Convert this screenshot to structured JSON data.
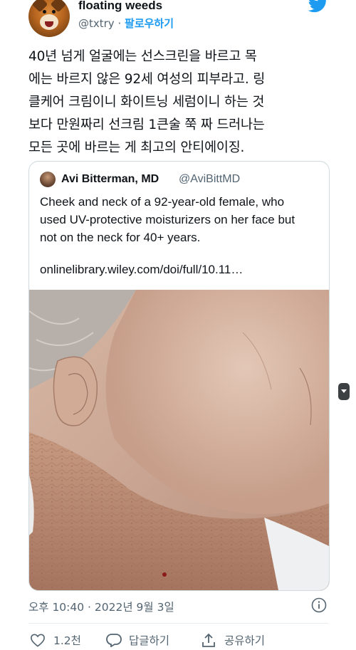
{
  "author": {
    "display_name": "floating weeds",
    "handle": "@txtry",
    "separator": "·",
    "follow_label": "팔로우하기",
    "avatar_icon": "dog-avatar",
    "brand_icon": "twitter-bird-icon",
    "brand_color": "#1d9bf0"
  },
  "tweet": {
    "lines": [
      "40년 넘게 얼굴에는 선스크린을 바르고 목",
      "에는 바르지 않은 92세 여성의 피부라고. 링",
      "클케어 크림이니 화이트닝 세럼이니 하는 것",
      "보다 만원짜리 선크림 1큰술 쭉 짜 드러나는",
      "모든 곳에 바르는 게 최고의 안티에이징."
    ]
  },
  "quoted": {
    "display_name": "Avi Bitterman, MD",
    "handle": "@AviBittMD",
    "text_lines": [
      "Cheek and neck of a 92-year-old female, who",
      "used UV-protective moisturizers on her face but",
      "not on the neck for 40+ years."
    ],
    "link": "onlinelibrary.wiley.com/doi/full/10.11…",
    "photo": "close-up-photo-of-cheek-and-neck"
  },
  "meta": {
    "timestamp": "오후 10:40 · 2022년 9월 3일",
    "info_icon": "info-icon"
  },
  "actions": {
    "like_count": "1.2천",
    "reply_label": "답글하기",
    "share_label": "공유하기"
  }
}
